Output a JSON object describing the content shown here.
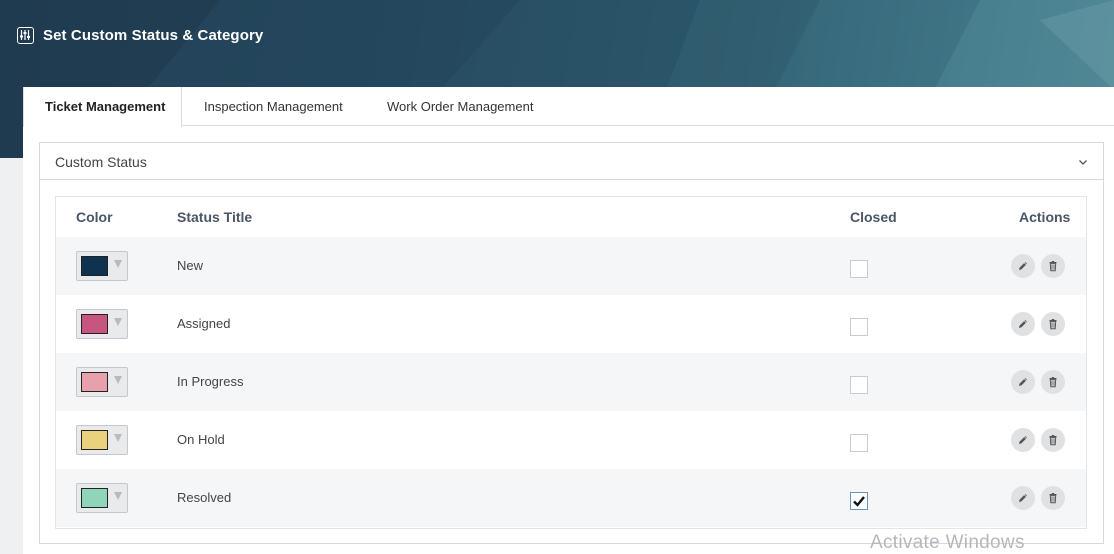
{
  "page": {
    "title": "Set Custom Status & Category",
    "title_icon": "sliders-icon"
  },
  "tabs": [
    {
      "label": "Ticket Management",
      "active": true
    },
    {
      "label": "Inspection Management",
      "active": false
    },
    {
      "label": "Work Order Management",
      "active": false
    }
  ],
  "section": {
    "title": "Custom Status",
    "toggle_icon": "chevron-down-icon"
  },
  "table": {
    "headers": {
      "color": "Color",
      "status_title": "Status Title",
      "closed": "Closed",
      "actions": "Actions"
    },
    "rows": [
      {
        "title": "New",
        "color": "#0f3250",
        "closed": false
      },
      {
        "title": "Assigned",
        "color": "#c6567f",
        "closed": false
      },
      {
        "title": "In Progress",
        "color": "#e8a1ac",
        "closed": false
      },
      {
        "title": "On Hold",
        "color": "#ead17c",
        "closed": false
      },
      {
        "title": "Resolved",
        "color": "#8fd5b9",
        "closed": true
      }
    ]
  },
  "watermark": "Activate Windows"
}
